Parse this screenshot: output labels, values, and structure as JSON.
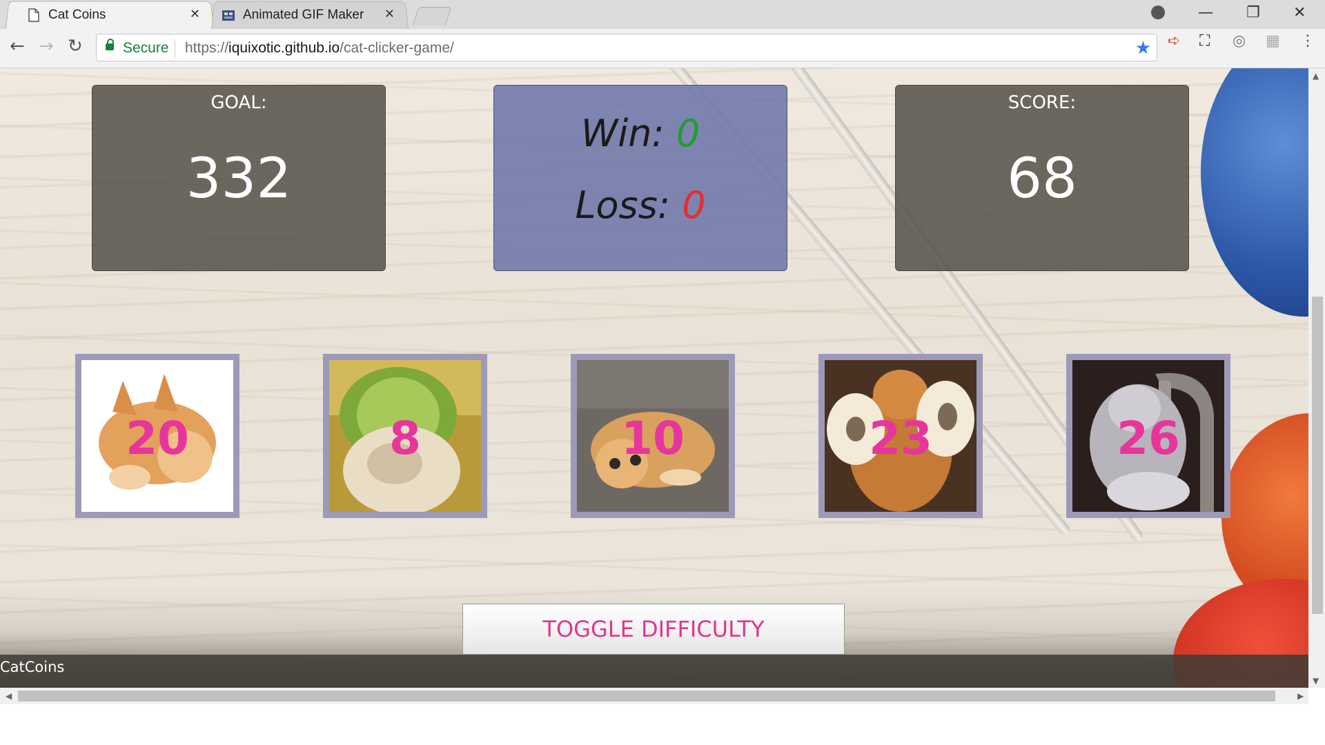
{
  "browser": {
    "tabs": [
      {
        "title": "Cat Coins",
        "active": true,
        "icon": "page-icon"
      },
      {
        "title": "Animated GIF Maker",
        "active": false,
        "icon": "gif-maker-favicon"
      }
    ],
    "secure_label": "Secure",
    "url_scheme": "https://",
    "url_domain": "iquixotic.github.io",
    "url_path": "/cat-clicker-game/",
    "close_glyph": "✕"
  },
  "game": {
    "goal_label": "GOAL:",
    "goal_value": "332",
    "win_label": "Win:",
    "win_value": "0",
    "loss_label": "Loss:",
    "loss_value": "0",
    "score_label": "SCORE:",
    "score_value": "68",
    "cats": [
      {
        "value": "20",
        "picture": "kitten-lying-down"
      },
      {
        "value": "8",
        "picture": "cat-with-lime-helmet"
      },
      {
        "value": "10",
        "picture": "kitten-on-couch"
      },
      {
        "value": "23",
        "picture": "cat-holding-toilet-paper"
      },
      {
        "value": "26",
        "picture": "kitten-at-faucet"
      }
    ],
    "toggle_label": "TOGGLE DIFFICULTY",
    "brand": "CatCoins"
  },
  "colors": {
    "win": "#1e9e2e",
    "loss": "#e03030",
    "cat_number": "#e7359c",
    "toggle_text": "#e0358f",
    "secure": "#188038",
    "star": "#3b78e7"
  }
}
